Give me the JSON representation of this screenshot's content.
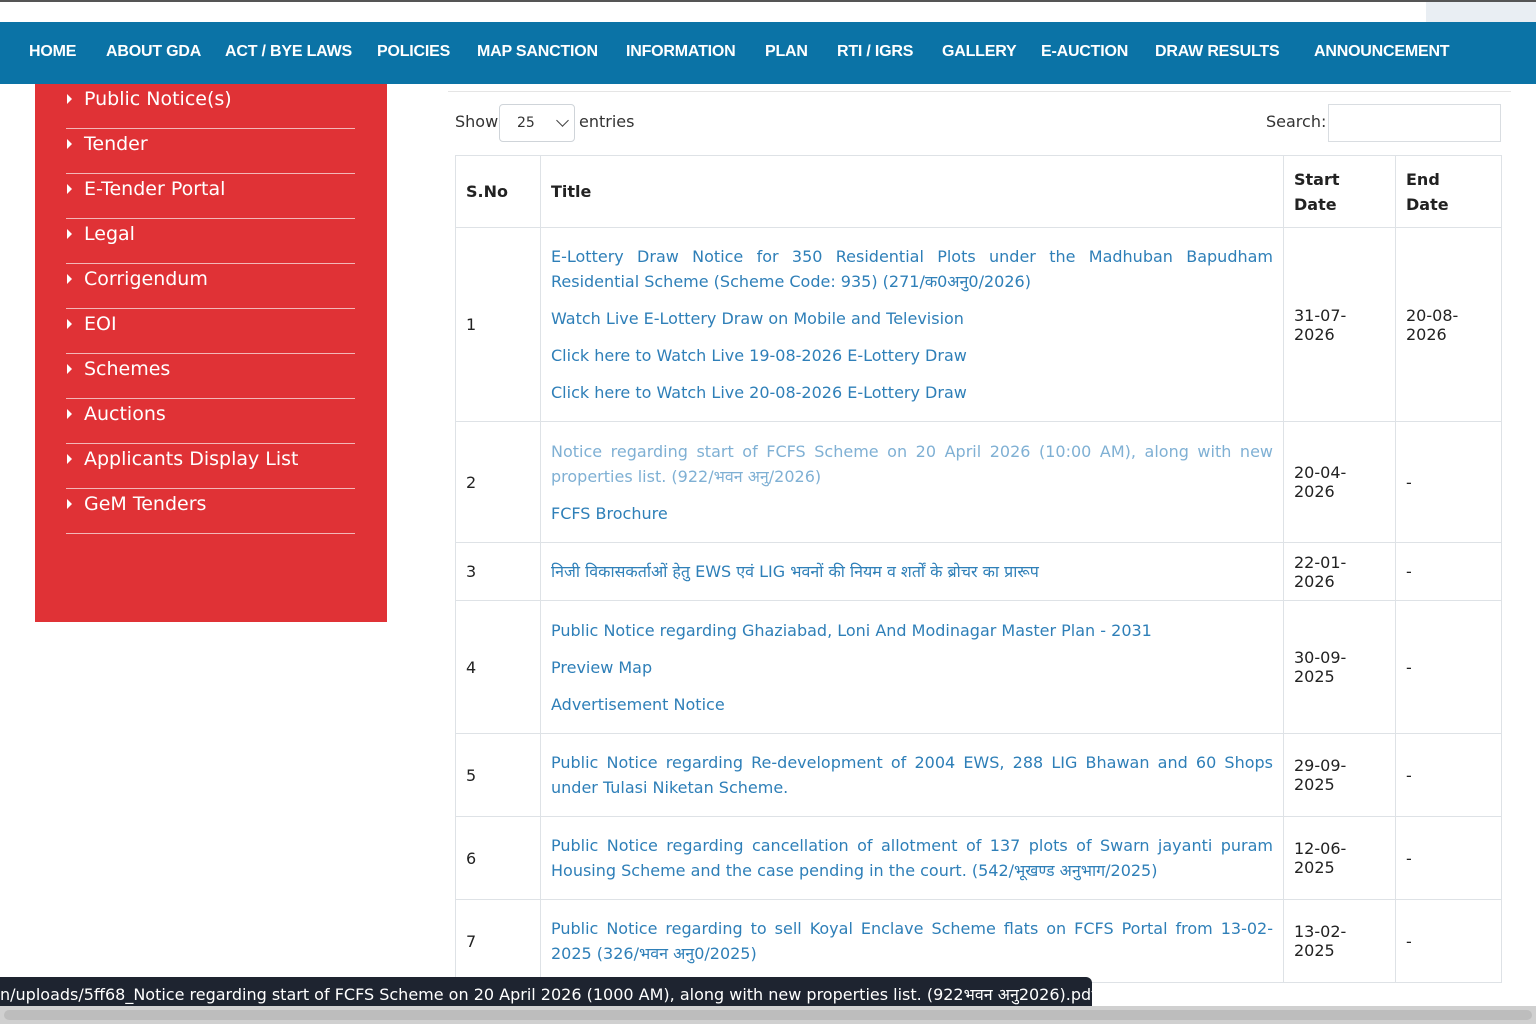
{
  "nav": {
    "items": [
      "HOME",
      "ABOUT GDA",
      "ACT / BYE LAWS",
      "POLICIES",
      "MAP SANCTION",
      "INFORMATION",
      "PLAN",
      "RTI / IGRS",
      "GALLERY",
      "E-AUCTION",
      "DRAW RESULTS",
      "ANNOUNCEMENT"
    ]
  },
  "sidebar": {
    "items": [
      "Public Notice(s)",
      "Tender",
      "E-Tender Portal",
      "Legal",
      "Corrigendum",
      "EOI",
      "Schemes",
      "Auctions",
      "Applicants Display List",
      "GeM Tenders"
    ]
  },
  "controls": {
    "show_label": "Show",
    "entries_value": "25",
    "entries_label": "entries",
    "search_label": "Search:",
    "search_value": ""
  },
  "table": {
    "headers": {
      "sno": "S.No",
      "title": "Title",
      "start_1": "Start",
      "start_2": "Date",
      "end_1": "End",
      "end_2": "Date"
    },
    "rows": [
      {
        "sno": "1",
        "links": [
          "E-Lottery Draw Notice for 350 Residential Plots under the Madhuban Bapudham Residential Scheme (Scheme Code: 935) (271/क0अनु0/2026)",
          "Watch Live E-Lottery Draw on Mobile and Television",
          "Click here to Watch Live 19-08-2026 E-Lottery Draw",
          "Click here to Watch Live 20-08-2026 E-Lottery Draw"
        ],
        "start": "31-07-2026",
        "end": "20-08-2026"
      },
      {
        "sno": "2",
        "links": [
          "Notice regarding start of FCFS Scheme on 20 April 2026 (10:00 AM), along with new properties list. (922/भवन अनु/2026)",
          "FCFS Brochure"
        ],
        "start": "20-04-2026",
        "end": "-"
      },
      {
        "sno": "3",
        "links": [
          "निजी विकासकर्ताओं हेतु EWS एवं LIG भवनों की नियम व शर्तों के ब्रोचर का प्रारूप"
        ],
        "start": "22-01-2026",
        "end": "-"
      },
      {
        "sno": "4",
        "links": [
          "Public Notice regarding Ghaziabad, Loni And Modinagar Master Plan - 2031",
          "Preview Map",
          "Advertisement Notice"
        ],
        "start": "30-09-2025",
        "end": "-"
      },
      {
        "sno": "5",
        "links": [
          "Public Notice regarding Re-development of 2004 EWS, 288 LIG Bhawan and 60 Shops under Tulasi Niketan Scheme."
        ],
        "start": "29-09-2025",
        "end": "-"
      },
      {
        "sno": "6",
        "links": [
          "Public Notice regarding cancellation of allotment of 137 plots of Swarn jayanti puram Housing Scheme and the case pending in the court. (542/भूखण्ड अनुभाग/2025)"
        ],
        "start": "12-06-2025",
        "end": "-"
      },
      {
        "sno": "7",
        "links": [
          "Public Notice regarding to sell Koyal Enclave Scheme flats on FCFS Portal from 13-02-2025 (326/भवन अनु0/2025)"
        ],
        "start": "13-02-2025",
        "end": "-"
      }
    ]
  },
  "status_bar": {
    "url": "n/uploads/5ff68_Notice regarding start of FCFS Scheme on 20 April 2026 (1000 AM), along with new properties list. (922भवन अनु2026).pdf"
  },
  "colors": {
    "nav_bg": "#0b73a6",
    "sidebar_bg": "#e03236",
    "link": "#2e7fb8",
    "visited_link": "#7fb0d4"
  }
}
